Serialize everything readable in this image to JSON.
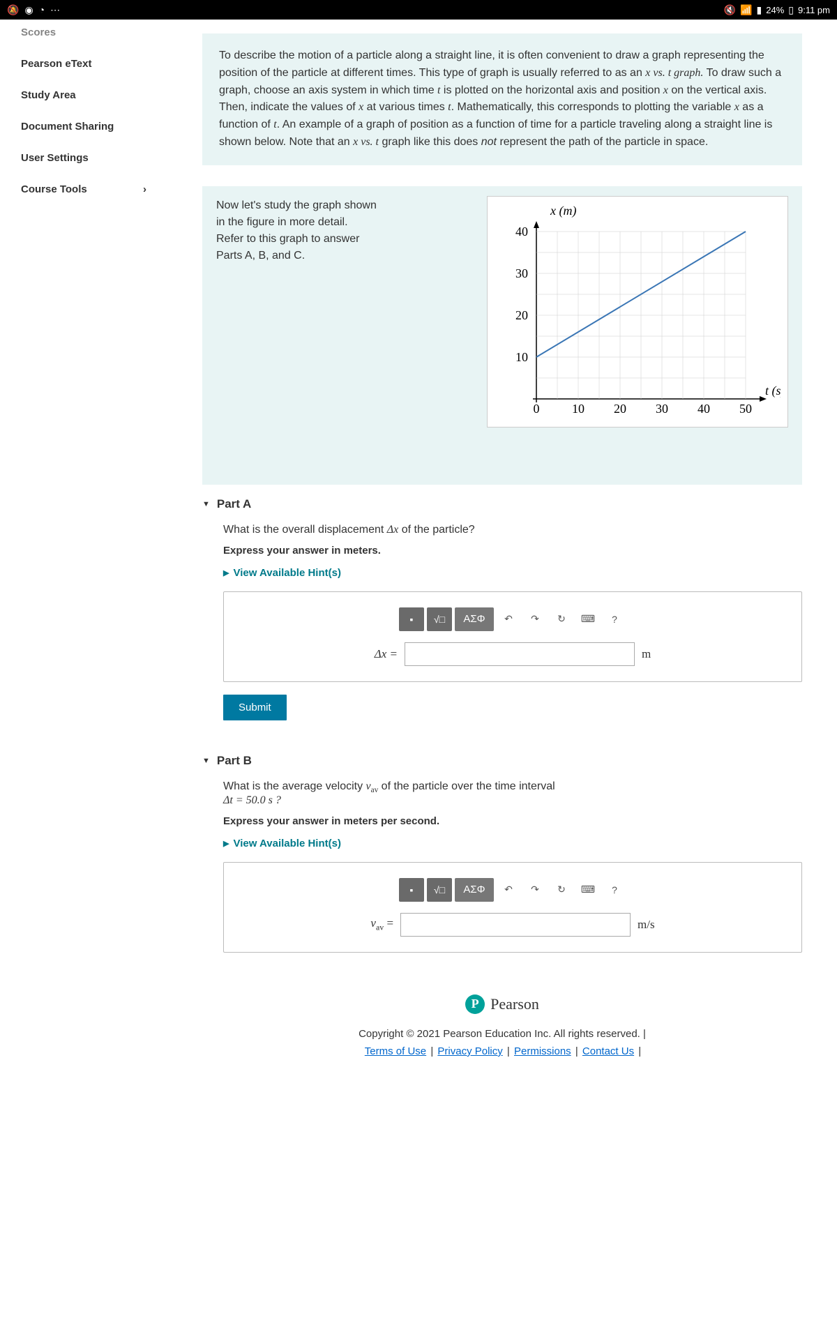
{
  "status_bar": {
    "battery": "24%",
    "time": "9:11 pm"
  },
  "sidebar": {
    "items": [
      {
        "label": "Scores"
      },
      {
        "label": "Pearson eText"
      },
      {
        "label": "Study Area"
      },
      {
        "label": "Document Sharing"
      },
      {
        "label": "User Settings"
      },
      {
        "label": "Course Tools"
      }
    ]
  },
  "intro": {
    "text_before_xvst": "To describe the motion of a particle along a straight line, it is often convenient to draw a graph representing the position of the particle at different times. This type of graph is usually referred to as an ",
    "xvst": "x vs. t graph.",
    "text_after_xvst": " To draw such a graph, choose an axis system in which time ",
    "t1": "t",
    "text_mid1": " is plotted on the horizontal axis and position ",
    "x1": "x",
    "text_mid2": " on the vertical axis. Then, indicate the values of ",
    "x2": "x",
    "text_mid3": " at various times ",
    "t2": "t",
    "text_mid4": ". Mathematically, this corresponds to plotting the variable ",
    "x3": "x",
    "text_mid5": " as a function of ",
    "t3": "t",
    "text_mid6": ". An example of a graph of position as a function of time for a particle traveling along a straight line is shown below. Note that an ",
    "xvst2": "x vs. t",
    "text_mid7": " graph like this does ",
    "not": "not",
    "text_end": " represent the path of the particle in space."
  },
  "graph_intro": {
    "text": "Now let's study the graph shown in the figure in more detail. Refer to this graph to answer Parts A, B, and C."
  },
  "chart_data": {
    "type": "line",
    "xlabel": "t (s)",
    "ylabel": "x (m)",
    "x": [
      0,
      50
    ],
    "y": [
      10,
      40
    ],
    "xlim": [
      0,
      50
    ],
    "ylim": [
      0,
      40
    ],
    "xticks": [
      0,
      10,
      20,
      30,
      40,
      50
    ],
    "yticks": [
      10,
      20,
      30,
      40
    ]
  },
  "partA": {
    "title": "Part A",
    "question_pre": "What is the overall displacement ",
    "question_var": "Δx",
    "question_post": " of the particle?",
    "instruction": "Express your answer in meters.",
    "hints": "View Available Hint(s)",
    "var_label": "Δx =",
    "unit": "m",
    "submit": "Submit",
    "tool_greek": "ΑΣΦ",
    "tool_help": "?"
  },
  "partB": {
    "title": "Part B",
    "question_pre": "What is the average velocity ",
    "question_var": "v",
    "question_sub": "av",
    "question_mid": " of the particle over the time interval ",
    "interval": "Δt = 50.0 s ?",
    "instruction": "Express your answer in meters per second.",
    "hints": "View Available Hint(s)",
    "var_label_v": "v",
    "var_label_sub": "av",
    "var_label_eq": " =",
    "unit": "m/s",
    "tool_greek": "ΑΣΦ",
    "tool_help": "?"
  },
  "brand": {
    "p": "P",
    "name": "Pearson"
  },
  "footer": {
    "copyright": "Copyright © 2021 Pearson Education Inc. All rights reserved. |",
    "terms": "Terms of Use",
    "privacy": "Privacy Policy",
    "permissions": "Permissions",
    "contact": "Contact Us"
  }
}
